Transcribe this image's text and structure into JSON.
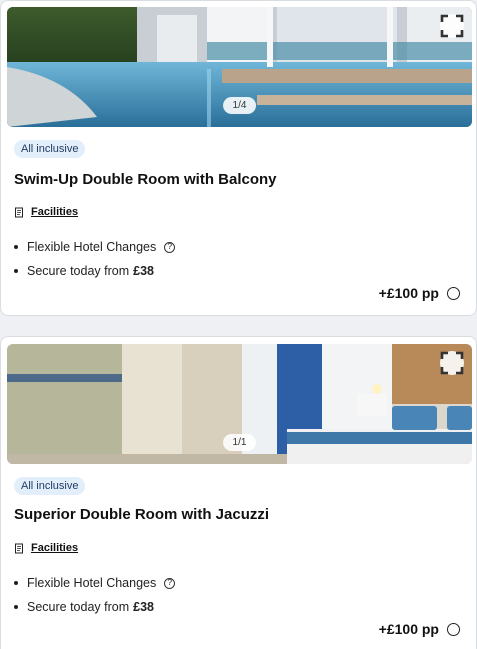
{
  "rooms": [
    {
      "badge": "All inclusive",
      "title": "Swim-Up Double Room with Balcony",
      "image_counter": "1/4",
      "facilities_label": "Facilities",
      "features": [
        {
          "text": "Flexible Hotel Changes",
          "has_info": true
        },
        {
          "text": "Secure today from",
          "amount": "£38"
        }
      ],
      "price": "+£100 pp",
      "icons": {
        "expand": "expand-icon",
        "facilities": "document-icon",
        "info": "info-icon",
        "select": "radio-button"
      }
    },
    {
      "badge": "All inclusive",
      "title": "Superior Double Room with Jacuzzi",
      "image_counter": "1/1",
      "facilities_label": "Facilities",
      "features": [
        {
          "text": "Flexible Hotel Changes",
          "has_info": true
        },
        {
          "text": "Secure today from",
          "amount": "£38"
        }
      ],
      "price": "+£100 pp",
      "icons": {
        "expand": "expand-icon",
        "facilities": "document-icon",
        "info": "info-icon",
        "select": "radio-button"
      }
    }
  ],
  "colors": {
    "badge_bg": "#e3eefb",
    "badge_text": "#1f3a5f",
    "card_bg": "#ffffff",
    "page_bg": "#eef0f3"
  }
}
